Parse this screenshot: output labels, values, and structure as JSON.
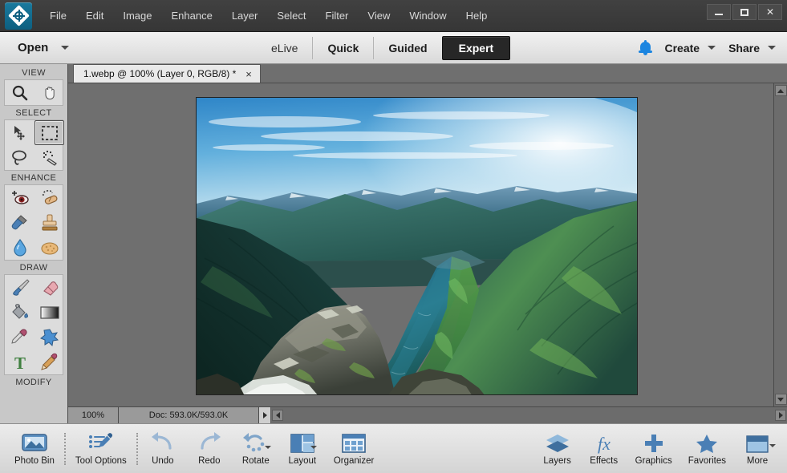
{
  "window": {
    "app_icon": "photoshop-elements-logo-icon",
    "controls": {
      "minimize": "minimize-icon",
      "maximize": "maximize-icon",
      "close": "✕"
    }
  },
  "menubar": {
    "items": [
      {
        "label": "File"
      },
      {
        "label": "Edit"
      },
      {
        "label": "Image"
      },
      {
        "label": "Enhance"
      },
      {
        "label": "Layer"
      },
      {
        "label": "Select"
      },
      {
        "label": "Filter"
      },
      {
        "label": "View"
      },
      {
        "label": "Window"
      },
      {
        "label": "Help"
      }
    ]
  },
  "modebar": {
    "open_label": "Open",
    "modes": [
      {
        "label": "eLive",
        "active": false
      },
      {
        "label": "Quick",
        "active": false
      },
      {
        "label": "Guided",
        "active": false
      },
      {
        "label": "Expert",
        "active": true
      }
    ],
    "notification_icon": "bell-icon",
    "create_label": "Create",
    "share_label": "Share"
  },
  "toolbox": {
    "sections": [
      {
        "label": "VIEW",
        "tools": [
          {
            "name": "zoom-tool",
            "icon": "magnifier-icon",
            "selected": false
          },
          {
            "name": "hand-tool",
            "icon": "hand-icon",
            "selected": false
          }
        ]
      },
      {
        "label": "SELECT",
        "tools": [
          {
            "name": "move-tool",
            "icon": "move-arrows-icon",
            "selected": false
          },
          {
            "name": "rectangular-marquee-tool",
            "icon": "marquee-icon",
            "selected": true
          },
          {
            "name": "lasso-tool",
            "icon": "lasso-icon",
            "selected": false
          },
          {
            "name": "quick-selection-tool",
            "icon": "magic-wand-icon",
            "selected": false
          }
        ]
      },
      {
        "label": "ENHANCE",
        "tools": [
          {
            "name": "red-eye-removal-tool",
            "icon": "eye-icon",
            "selected": false
          },
          {
            "name": "spot-healing-brush-tool",
            "icon": "bandage-icon",
            "selected": false
          },
          {
            "name": "smart-brush-tool",
            "icon": "smart-brush-icon",
            "selected": false
          },
          {
            "name": "clone-stamp-tool",
            "icon": "stamp-icon",
            "selected": false
          },
          {
            "name": "blur-tool",
            "icon": "water-drop-icon",
            "selected": false
          },
          {
            "name": "sponge-tool",
            "icon": "sponge-icon",
            "selected": false
          }
        ]
      },
      {
        "label": "DRAW",
        "tools": [
          {
            "name": "brush-tool",
            "icon": "paintbrush-icon",
            "selected": false
          },
          {
            "name": "eraser-tool",
            "icon": "eraser-icon",
            "selected": false
          },
          {
            "name": "paint-bucket-tool",
            "icon": "paint-bucket-icon",
            "selected": false
          },
          {
            "name": "gradient-tool",
            "icon": "gradient-icon",
            "selected": false
          },
          {
            "name": "color-picker-tool",
            "icon": "eyedropper-icon",
            "selected": false
          },
          {
            "name": "custom-shape-tool",
            "icon": "shape-blob-icon",
            "selected": false
          },
          {
            "name": "type-tool",
            "icon": "text-t-icon",
            "selected": false
          },
          {
            "name": "pencil-tool",
            "icon": "pencil-icon",
            "selected": false
          }
        ]
      },
      {
        "label": "MODIFY",
        "tools": []
      }
    ]
  },
  "document": {
    "tab_title": "1.webp @ 100% (Layer 0, RGB/8) *",
    "close_icon": "×",
    "image_alt": "norwegian-fjord-landscape"
  },
  "statusbar": {
    "zoom": "100%",
    "doc_info": "Doc: 593.0K/593.0K",
    "play_icon": "play-arrow-icon"
  },
  "taskbar": {
    "left_items": [
      {
        "label": "Photo Bin",
        "icon": "photo-bin-icon"
      },
      {
        "label": "Tool Options",
        "icon": "tool-options-icon"
      },
      {
        "label": "Undo",
        "icon": "undo-arrow-icon"
      },
      {
        "label": "Redo",
        "icon": "redo-arrow-icon"
      },
      {
        "label": "Rotate",
        "icon": "rotate-icon"
      },
      {
        "label": "Layout",
        "icon": "layout-icon"
      },
      {
        "label": "Organizer",
        "icon": "organizer-grid-icon"
      }
    ],
    "right_items": [
      {
        "label": "Layers",
        "icon": "layers-stack-icon"
      },
      {
        "label": "Effects",
        "icon": "fx-icon"
      },
      {
        "label": "Graphics",
        "icon": "plus-icon"
      },
      {
        "label": "Favorites",
        "icon": "star-icon"
      },
      {
        "label": "More",
        "icon": "more-panel-icon"
      }
    ]
  },
  "colors": {
    "accent_blue": "#1b85e0",
    "icon_blue": "#4a7fb5",
    "titlebar": "#3c3c3c",
    "canvas_bg": "#6f6f6f",
    "toolbox_bg": "#c8c8c8"
  }
}
